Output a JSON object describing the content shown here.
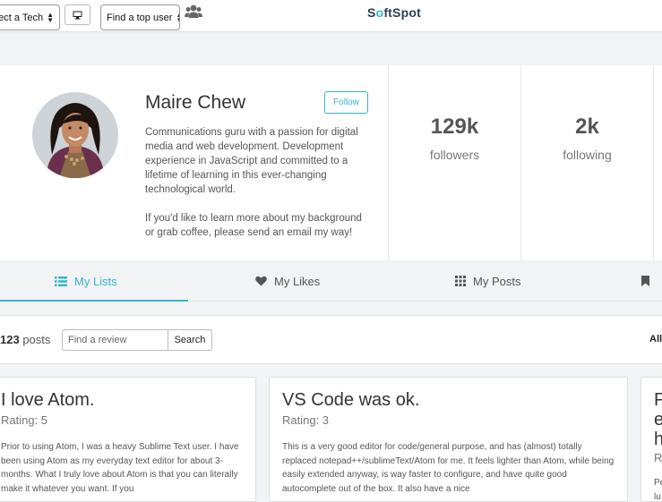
{
  "header": {
    "tech_select": "elect a Tech",
    "user_select": "Find a top user",
    "logo_prefix": "S",
    "logo_accent": "o",
    "logo_suffix": "ftSpot"
  },
  "profile": {
    "name": "Maire Chew",
    "follow_label": "Follow",
    "bio_p1": "Communications guru with a passion for digital media and web development. Development experience in JavaScript and committed to a lifetime of learning in this ever-changing technological world.",
    "bio_p2": "If you'd like to learn more about my background or grab coffee, please send an email my way!",
    "stats": [
      {
        "value": "129k",
        "label": "followers"
      },
      {
        "value": "2k",
        "label": "following"
      }
    ]
  },
  "tabs": [
    {
      "label": "My Lists",
      "icon": "list-icon"
    },
    {
      "label": "My Likes",
      "icon": "heart-icon"
    },
    {
      "label": "My Posts",
      "icon": "grid-icon"
    },
    {
      "label": "",
      "icon": "bookmark-icon"
    }
  ],
  "posts": {
    "count": "123",
    "count_suffix": "posts",
    "search_placeholder": "Find a review",
    "search_label": "Search",
    "filter_label": "All"
  },
  "cards": [
    {
      "title": "I love Atom.",
      "rating": "Rating: 5",
      "body": "Prior to using Atom, I was a heavy Sublime Text user. I have been using Atom as my everyday text editor for about 3-months. What I truly love about Atom is that you can literally make it whatever you want. If you"
    },
    {
      "title": "VS Code was ok.",
      "rating": "Rating: 3",
      "body": "This is a very good editor for code/general purpose, and has (almost) totally replaced notepad++/sublimeText/Atom for me. It feels lighter than Atom, while being easily extended anyway, is way faster to configure, and have quite good autocomplete out of the box. It also have a nice"
    },
    {
      "title": "P e h",
      "rating": "R",
      "body": "Pe lu"
    }
  ],
  "colors": {
    "accent": "#36b5c8",
    "background": "#f1f3f4"
  }
}
